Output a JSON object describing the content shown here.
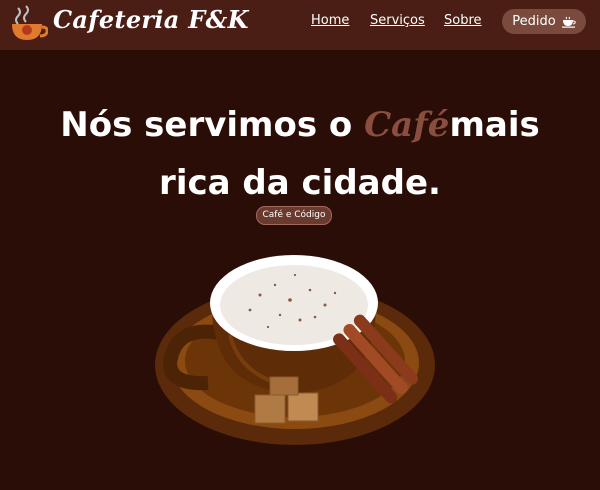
{
  "brand": {
    "name": "Cafeteria F&K",
    "icon": "coffee-cup-logo-icon"
  },
  "nav": {
    "links": [
      "Home",
      "Serviços",
      "Sobre"
    ],
    "order_button": {
      "label": "Pedido",
      "icon": "coffee-cup-icon"
    }
  },
  "hero": {
    "headline_prefix": "Nós servimos o ",
    "headline_accent": "Café",
    "headline_suffix": "mais",
    "headline_line2": "rica da cidade.",
    "tag": "Café e Código",
    "image": "coffee-cup-with-cinnamon-and-sugar-cubes"
  },
  "colors": {
    "background": "#2a0d06",
    "navbar": "#4a1e15",
    "accent": "#8a4e3f",
    "button": "#7a4a3d"
  }
}
